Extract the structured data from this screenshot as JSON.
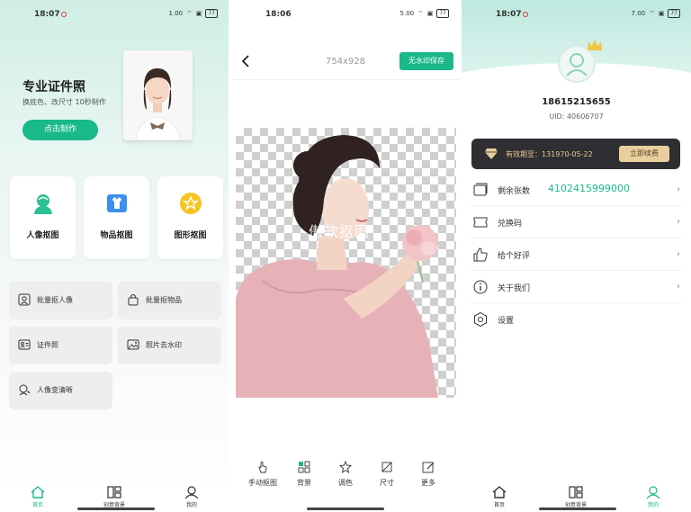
{
  "screen1": {
    "status": {
      "time": "18:07",
      "net_speed": "1.00",
      "battery": "77"
    },
    "hero": {
      "title": "专业证件照",
      "subtitle": "换底色、改尺寸 10秒制作",
      "button": "点击制作"
    },
    "tiles": [
      {
        "label": "人像抠图",
        "icon": "portrait-icon"
      },
      {
        "label": "物品抠图",
        "icon": "shirt-icon"
      },
      {
        "label": "图形抠图",
        "icon": "star-icon"
      }
    ],
    "features": [
      {
        "label": "批量抠人像",
        "icon": "batch-portrait-icon"
      },
      {
        "label": "批量抠物品",
        "icon": "bag-icon"
      },
      {
        "label": "证件照",
        "icon": "id-card-icon"
      },
      {
        "label": "照片去水印",
        "icon": "image-icon"
      },
      {
        "label": "人像变清晰",
        "icon": "face-enhance-icon"
      }
    ],
    "tabs": [
      {
        "label": "首页",
        "active": true
      },
      {
        "label": "创意背景",
        "active": false
      },
      {
        "label": "我的",
        "active": false
      }
    ]
  },
  "screen2": {
    "status": {
      "time": "18:06",
      "net_speed": "5.00",
      "battery": "77"
    },
    "dimensions": "754x928",
    "save_button": "无水印保存",
    "watermark": "傲软抠图",
    "tools": [
      {
        "label": "手动抠图",
        "icon": "hand-icon"
      },
      {
        "label": "背景",
        "icon": "background-icon"
      },
      {
        "label": "调色",
        "icon": "adjust-color-icon"
      },
      {
        "label": "尺寸",
        "icon": "crop-icon"
      },
      {
        "label": "更多",
        "icon": "edit-icon"
      }
    ]
  },
  "screen3": {
    "status": {
      "time": "18:07",
      "net_speed": "7.00",
      "battery": "77"
    },
    "user": {
      "name": "18615215655",
      "uid": "UID: 40606707"
    },
    "vip": {
      "expiry": "有效期至：131970-05-22",
      "renew_button": "立即续费"
    },
    "menu": [
      {
        "label": "剩余张数",
        "value": "4102415999000",
        "icon": "images-icon",
        "chevron": true
      },
      {
        "label": "兑换码",
        "value": "",
        "icon": "ticket-icon",
        "chevron": true
      },
      {
        "label": "给个好评",
        "value": "",
        "icon": "thumbs-up-icon",
        "chevron": true
      },
      {
        "label": "关于我们",
        "value": "",
        "icon": "info-icon",
        "chevron": true
      },
      {
        "label": "设置",
        "value": "",
        "icon": "settings-icon",
        "chevron": false
      }
    ],
    "tabs": [
      {
        "label": "首页",
        "active": false
      },
      {
        "label": "创意背景",
        "active": false
      },
      {
        "label": "我的",
        "active": true
      }
    ]
  },
  "colors": {
    "accent": "#19b98a",
    "vip_bg": "#2f2f33",
    "vip_gold": "#e9cf9e"
  }
}
